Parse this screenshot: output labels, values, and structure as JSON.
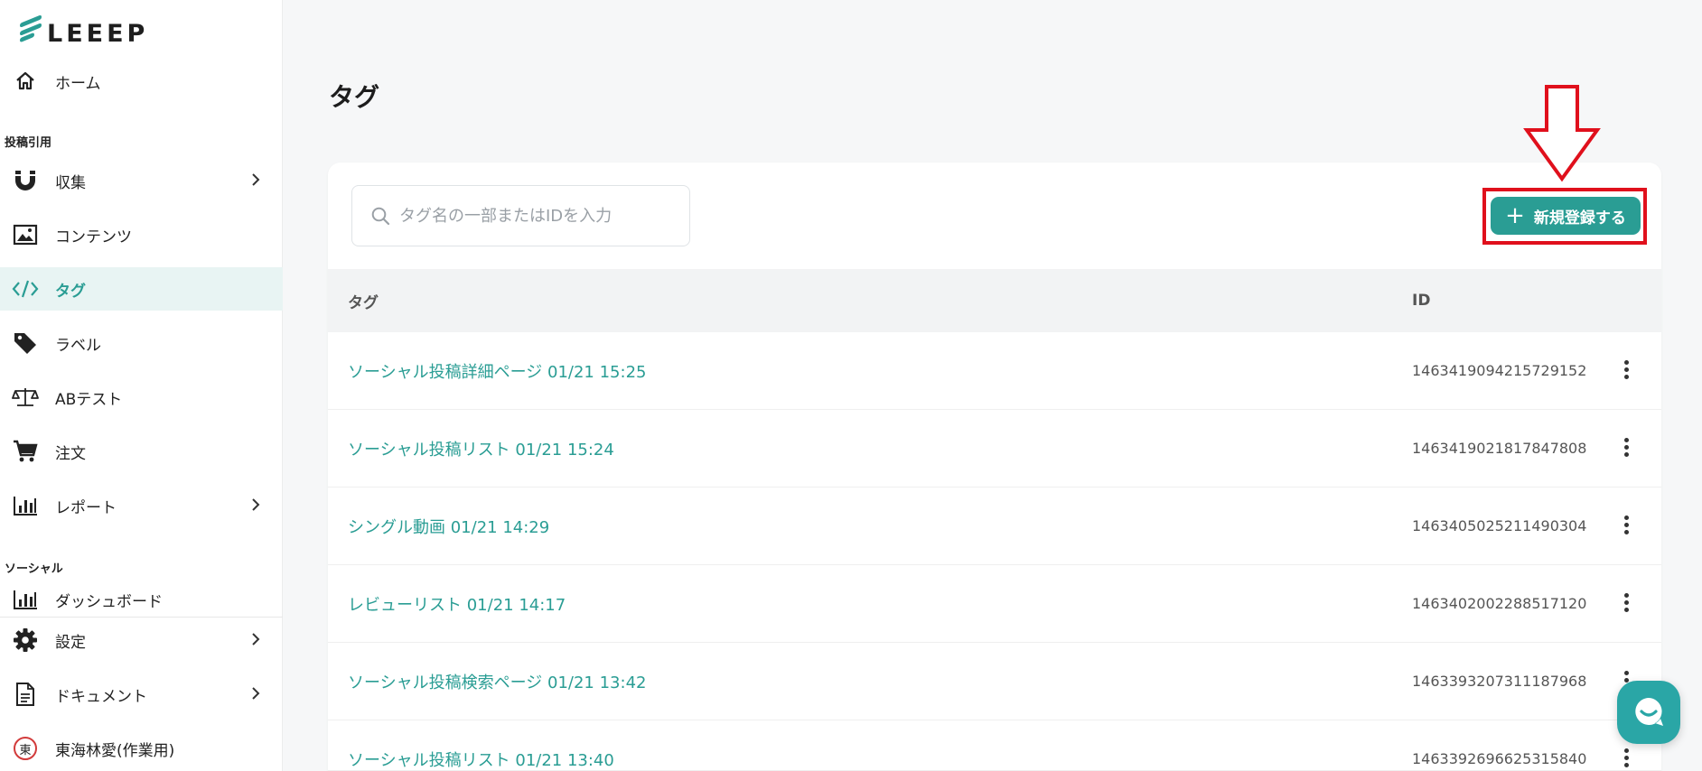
{
  "app": {
    "logo_text": "LEEEP"
  },
  "sidebar": {
    "home": "ホーム",
    "section_posts": "投稿引用",
    "items": [
      {
        "label": "収集",
        "icon": "magnet-icon"
      },
      {
        "label": "コンテンツ",
        "icon": "image-icon"
      },
      {
        "label": "タグ",
        "icon": "code-icon"
      },
      {
        "label": "ラベル",
        "icon": "label-icon"
      },
      {
        "label": "ABテスト",
        "icon": "scale-icon"
      },
      {
        "label": "注文",
        "icon": "cart-icon"
      },
      {
        "label": "レポート",
        "icon": "bar-chart-icon"
      }
    ],
    "section_social": "ソーシャル",
    "dashboard": "ダッシュボード",
    "settings": "設定",
    "documents": "ドキュメント",
    "user": "東海林愛(作業用)",
    "user_avatar_char": "東"
  },
  "page": {
    "title": "タグ"
  },
  "search": {
    "placeholder": "タグ名の一部またはIDを入力"
  },
  "toolbar": {
    "new_button": "新規登録する"
  },
  "table": {
    "headers": {
      "tag": "タグ",
      "id": "ID"
    },
    "rows": [
      {
        "name": "ソーシャル投稿詳細ページ 01/21 15:25",
        "id": "1463419094215729152"
      },
      {
        "name": "ソーシャル投稿リスト 01/21 15:24",
        "id": "1463419021817847808"
      },
      {
        "name": "シングル動画 01/21 14:29",
        "id": "1463405025211490304"
      },
      {
        "name": "レビューリスト 01/21 14:17",
        "id": "1463402002288517120"
      },
      {
        "name": "ソーシャル投稿検索ページ 01/21 13:42",
        "id": "1463393207311187968"
      },
      {
        "name": "ソーシャル投稿リスト 01/21 13:40",
        "id": "1463392696625315840"
      }
    ]
  },
  "colors": {
    "accent": "#2a9d94",
    "annotation": "#e0101c"
  }
}
